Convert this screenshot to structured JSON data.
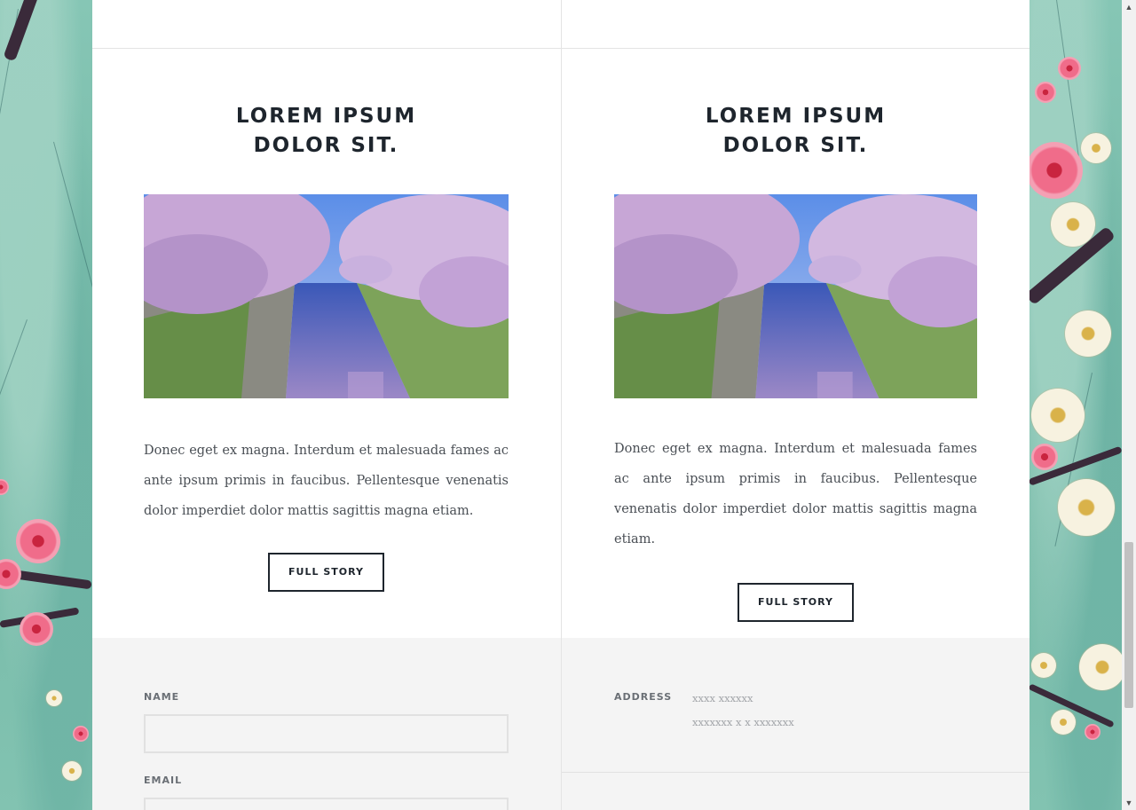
{
  "posts": [
    {
      "title_line1": "LOREM IPSUM",
      "title_line2": "DOLOR SIT.",
      "image_alt": "cherry-blossom-canal-photo",
      "text": "Donec eget ex magna. Interdum et malesuada fames ac ante ipsum primis in faucibus. Pellentesque venenatis dolor imperdiet dolor mattis sagittis magna etiam.",
      "button_label": "FULL STORY"
    },
    {
      "title_line1": "LOREM IPSUM",
      "title_line2": "DOLOR SIT.",
      "image_alt": "cherry-blossom-canal-photo",
      "text": "Donec eget ex magna. Interdum et malesuada fames ac ante ipsum primis in faucibus. Pellentesque venenatis dolor imperdiet dolor mattis sagittis magna etiam.",
      "button_label": "FULL STORY"
    }
  ],
  "contact_form": {
    "name_label": "NAME",
    "name_value": "",
    "email_label": "EMAIL",
    "email_value": ""
  },
  "contact_info": {
    "address_label": "ADDRESS",
    "address_line1": "xxxx xxxxxx",
    "address_line2": "xxxxxxx x x xxxxxxx"
  },
  "colors": {
    "accent_dark": "#1e252d",
    "footer_bg": "#f4f4f4",
    "page_bg": "#7fbfae"
  },
  "icons": {
    "scroll_up": "chevron-up-icon",
    "scroll_down": "chevron-down-icon"
  }
}
